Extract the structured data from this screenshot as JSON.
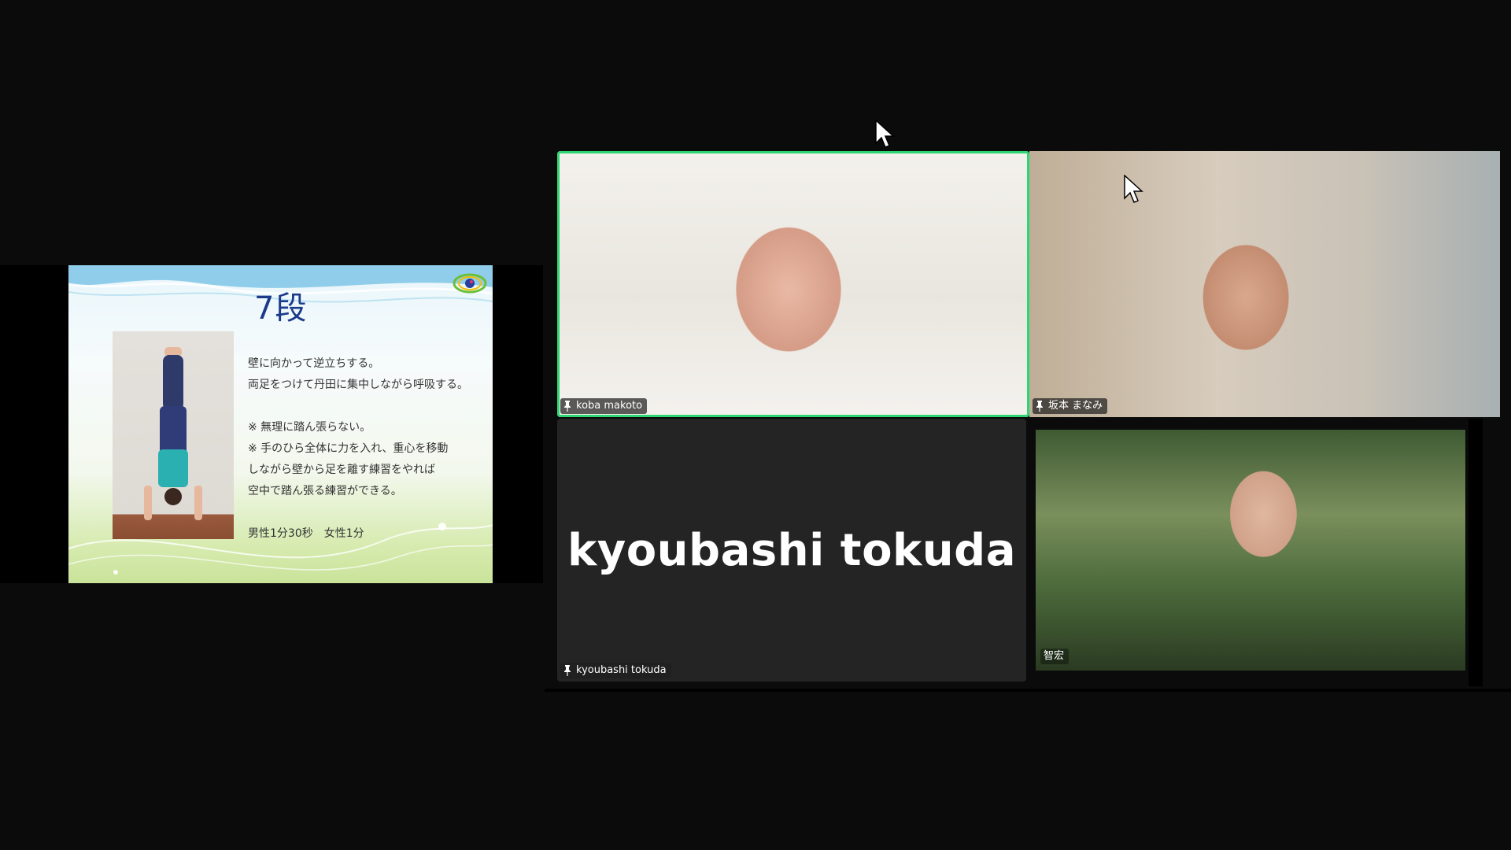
{
  "slide": {
    "title": "7段",
    "lines": [
      "壁に向かって逆立ちする。",
      "両足をつけて丹田に集中しながら呼吸する。",
      "",
      "※ 無理に踏ん張らない。",
      "※ 手のひら全体に力を入れ、重心を移動",
      "しながら壁から足を離す練習をやれば",
      "空中で踏ん張る練習ができる。"
    ],
    "footer": "男性1分30秒　女性1分"
  },
  "participants": [
    {
      "name": "koba makoto",
      "pinned": true,
      "video": true,
      "active_speaker": true
    },
    {
      "name": "坂本 まなみ",
      "pinned": true,
      "video": true,
      "active_speaker": false
    },
    {
      "name": "kyoubashi tokuda",
      "pinned": true,
      "video": false,
      "display_name": "kyoubashi tokuda",
      "active_speaker": false
    },
    {
      "name": "智宏",
      "pinned": false,
      "video": true,
      "active_speaker": false
    }
  ],
  "colors": {
    "active_speaker_border": "#2ed573",
    "background": "#0b0b0b",
    "slide_title": "#1b3a8a"
  },
  "icons": [
    "pin-icon",
    "mouse-cursor-icon"
  ]
}
